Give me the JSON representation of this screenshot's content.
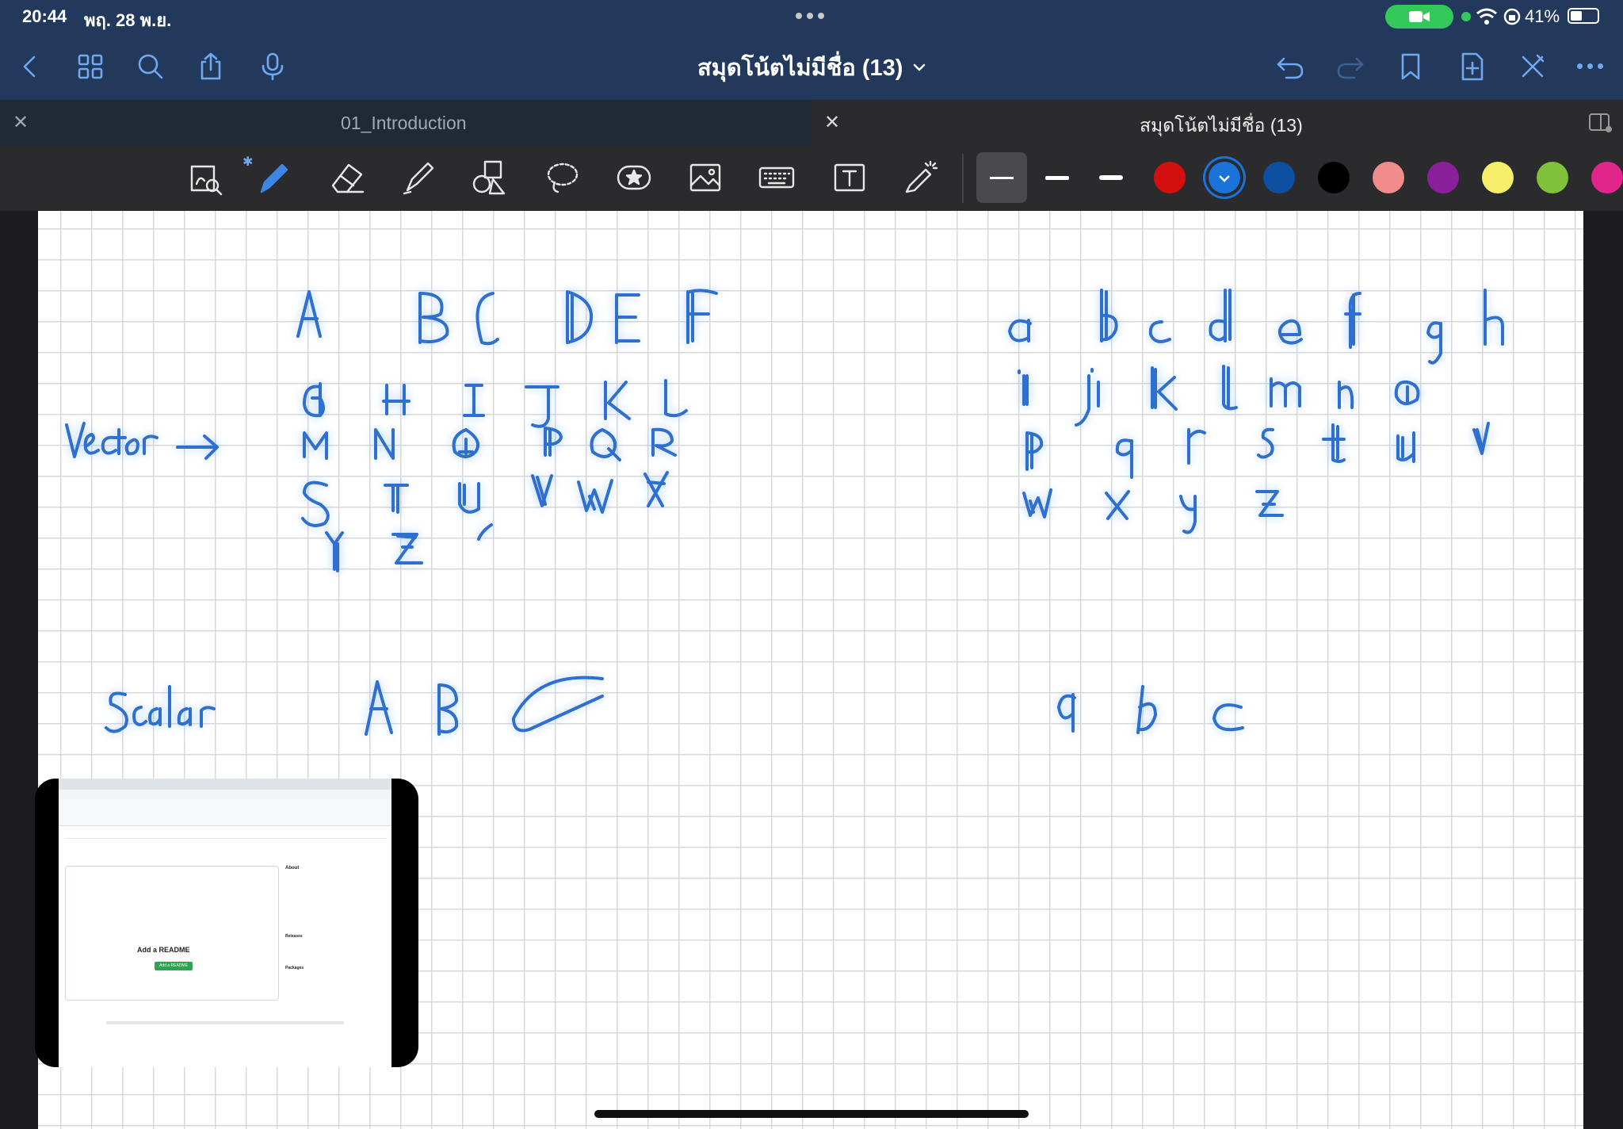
{
  "status": {
    "time": "20:44",
    "date": "พฤ. 28 พ.ย.",
    "battery": "41%",
    "icons": [
      "camera-icon",
      "wifi-icon",
      "rotation-lock-icon",
      "battery-icon"
    ]
  },
  "nav": {
    "title": "สมุดโน้ตไม่มีชื่อ (13)",
    "left_icons": [
      "back-icon",
      "grid-icon",
      "search-icon",
      "share-icon",
      "microphone-icon"
    ],
    "right_icons": [
      "undo-icon",
      "redo-icon",
      "bookmark-icon",
      "add-page-icon",
      "close-tools-icon",
      "more-icon"
    ]
  },
  "tabs": [
    {
      "label": "01_Introduction",
      "active": false
    },
    {
      "label": "สมุดโน้ตไม่มีชื่อ (13)",
      "active": true
    }
  ],
  "toolbar": {
    "tools": [
      "zoom-tool-icon",
      "pen-tool-icon",
      "eraser-tool-icon",
      "highlighter-tool-icon",
      "shapes-tool-icon",
      "lasso-tool-icon",
      "sticker-tool-icon",
      "image-tool-icon",
      "keyboard-tool-icon",
      "text-tool-icon",
      "laser-pointer-icon"
    ],
    "colors": [
      "#d40f0f",
      "#1a73d9",
      "#0d4fa0",
      "#000000",
      "#f08c8c",
      "#8a1f9c",
      "#f7ef6a",
      "#7fc23a",
      "#e0268a"
    ],
    "selected_color": "#1a73d9"
  },
  "pip": {
    "readme_title": "Add a README",
    "readme_button": "Add a README",
    "about": "About",
    "releases": "Releases",
    "packages": "Packages"
  }
}
